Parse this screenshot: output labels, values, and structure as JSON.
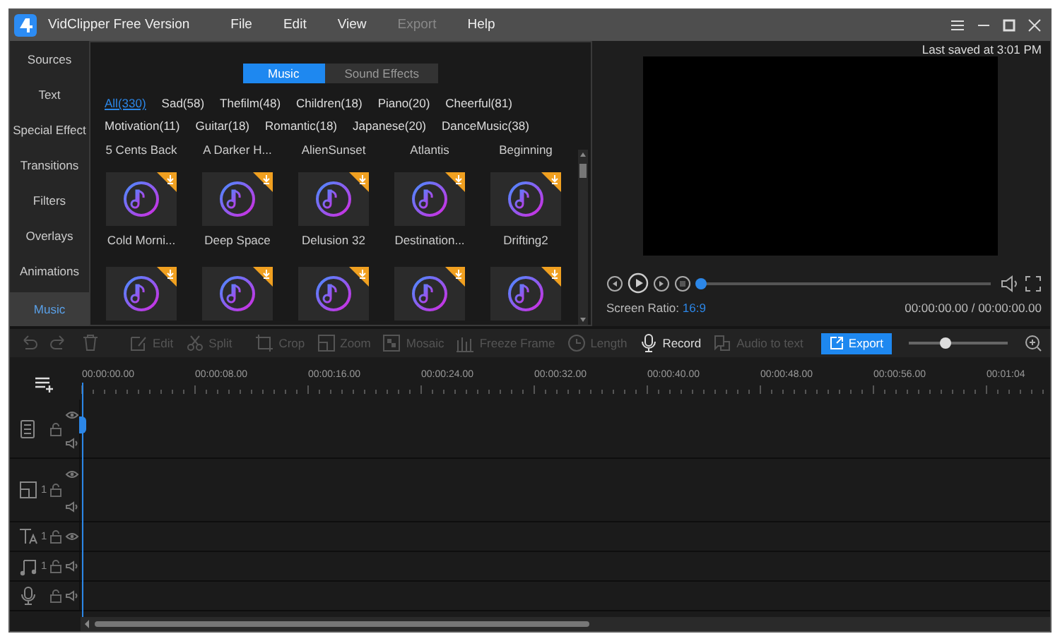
{
  "app": {
    "title": "VidClipper Free Version"
  },
  "menu": [
    {
      "label": "File",
      "disabled": false
    },
    {
      "label": "Edit",
      "disabled": false
    },
    {
      "label": "View",
      "disabled": false
    },
    {
      "label": "Export",
      "disabled": true
    },
    {
      "label": "Help",
      "disabled": false
    }
  ],
  "sidebar": {
    "items": [
      {
        "label": "Sources",
        "selected": false
      },
      {
        "label": "Text",
        "selected": false
      },
      {
        "label": "Special Effect",
        "selected": false
      },
      {
        "label": "Transitions",
        "selected": false
      },
      {
        "label": "Filters",
        "selected": false
      },
      {
        "label": "Overlays",
        "selected": false
      },
      {
        "label": "Animations",
        "selected": false
      },
      {
        "label": "Music",
        "selected": true
      }
    ]
  },
  "media": {
    "tabs": [
      {
        "label": "Music",
        "selected": true
      },
      {
        "label": "Sound Effects",
        "selected": false
      }
    ],
    "categories": [
      {
        "label": "All(330)",
        "selected": true
      },
      {
        "label": "Sad(58)",
        "selected": false
      },
      {
        "label": "Thefilm(48)",
        "selected": false
      },
      {
        "label": "Children(18)",
        "selected": false
      },
      {
        "label": "Piano(20)",
        "selected": false
      },
      {
        "label": "Cheerful(81)",
        "selected": false
      },
      {
        "label": "Motivation(11)",
        "selected": false
      },
      {
        "label": "Guitar(18)",
        "selected": false
      },
      {
        "label": "Romantic(18)",
        "selected": false
      },
      {
        "label": "Japanese(20)",
        "selected": false
      },
      {
        "label": "DanceMusic(38)",
        "selected": false
      }
    ],
    "items": [
      {
        "kind": "caption",
        "name": "5 Cents Back"
      },
      {
        "kind": "caption",
        "name": "A Darker H..."
      },
      {
        "kind": "caption",
        "name": "AlienSunset"
      },
      {
        "kind": "caption",
        "name": "Atlantis"
      },
      {
        "kind": "caption",
        "name": "Beginning"
      },
      {
        "kind": "tile",
        "name": "Cold Morni..."
      },
      {
        "kind": "tile",
        "name": "Deep Space"
      },
      {
        "kind": "tile",
        "name": "Delusion 32"
      },
      {
        "kind": "tile",
        "name": "Destination..."
      },
      {
        "kind": "tile",
        "name": "Drifting2"
      },
      {
        "kind": "tile-cut"
      },
      {
        "kind": "tile-cut"
      },
      {
        "kind": "tile-cut"
      },
      {
        "kind": "tile-cut"
      },
      {
        "kind": "tile-cut"
      }
    ]
  },
  "preview": {
    "last_saved": "Last saved at 3:01 PM",
    "ratio_label": "Screen Ratio:",
    "ratio_value": "16:9",
    "time": "00:00:00.00 / 00:00:00.00",
    "playback": {
      "level": 0
    }
  },
  "toolbar": {
    "tools": [
      {
        "kind": "undo",
        "disabled": true
      },
      {
        "kind": "redo",
        "disabled": true
      },
      {
        "kind": "delete",
        "disabled": true
      },
      {
        "kind": "edit",
        "label": "Edit",
        "disabled": true
      },
      {
        "kind": "split",
        "label": "Split",
        "disabled": true
      },
      {
        "kind": "crop",
        "label": "Crop",
        "disabled": true
      },
      {
        "kind": "zoom",
        "label": "Zoom",
        "disabled": true
      },
      {
        "kind": "mosaic",
        "label": "Mosaic",
        "disabled": true
      },
      {
        "kind": "freeze",
        "label": "Freeze Frame",
        "disabled": true
      },
      {
        "kind": "length",
        "label": "Length",
        "disabled": true
      },
      {
        "kind": "record",
        "label": "Record",
        "disabled": false
      },
      {
        "kind": "audio",
        "label": "Audio to text",
        "disabled": true
      }
    ],
    "export": "Export",
    "zoom": {
      "level": 0.37
    }
  },
  "timeline": {
    "ruler": [
      "00:00:00.00",
      "00:00:08.00",
      "00:00:16.00",
      "00:00:24.00",
      "00:00:32.00",
      "00:00:40.00",
      "00:00:48.00",
      "00:00:56.00",
      "00:01:04"
    ],
    "tracks": [
      {
        "kind": "video"
      },
      {
        "kind": "overlay",
        "count": "1"
      },
      {
        "kind": "text",
        "count": "1"
      },
      {
        "kind": "music",
        "count": "1"
      },
      {
        "kind": "voice"
      }
    ]
  }
}
